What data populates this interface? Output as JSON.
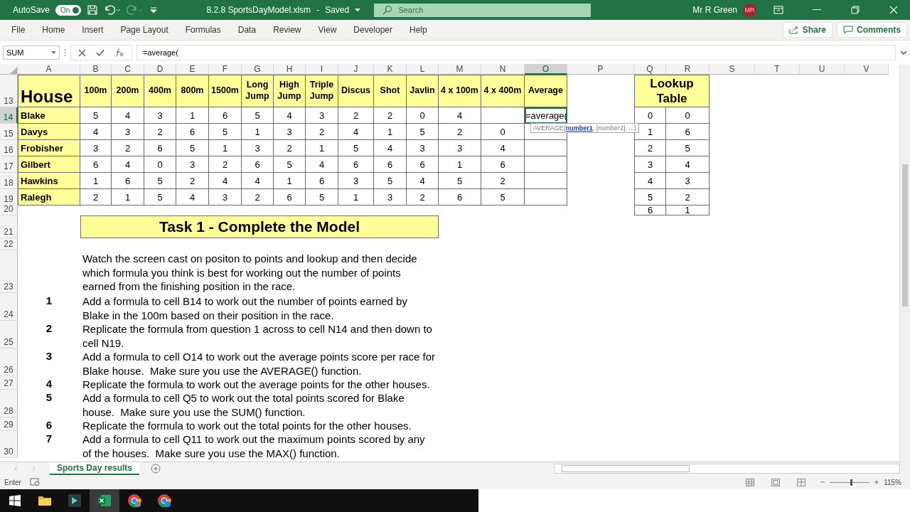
{
  "title_bar": {
    "autosave": "AutoSave",
    "autosave_toggle": {
      "label": "On",
      "on": true
    },
    "file_name": "8.2.8 SportsDayModel.xlsm",
    "separator": "-",
    "status": "Saved",
    "search": {
      "placeholder": "Search"
    },
    "user": "Mr R Green",
    "avatar": "MR"
  },
  "ribbon_tabs": [
    "File",
    "Home",
    "Insert",
    "Page Layout",
    "Formulas",
    "Data",
    "Review",
    "View",
    "Developer",
    "Help"
  ],
  "ribbon_buttons": [
    "Share",
    "Comments"
  ],
  "formula_bar": {
    "name_box": "SUM",
    "formula": "=average("
  },
  "columns": [
    {
      "label": "A",
      "selected": false
    },
    {
      "label": "B",
      "selected": false
    },
    {
      "label": "C",
      "selected": false
    },
    {
      "label": "D",
      "selected": false
    },
    {
      "label": "E",
      "selected": false
    },
    {
      "label": "F",
      "selected": false
    },
    {
      "label": "G",
      "selected": false
    },
    {
      "label": "H",
      "selected": false
    },
    {
      "label": "I",
      "selected": false
    },
    {
      "label": "J",
      "selected": false
    },
    {
      "label": "K",
      "selected": false
    },
    {
      "label": "L",
      "selected": false
    },
    {
      "label": "M",
      "selected": false
    },
    {
      "label": "N",
      "selected": false
    },
    {
      "label": "O",
      "selected": true
    },
    {
      "label": "P",
      "selected": false
    },
    {
      "label": "Q",
      "selected": false
    },
    {
      "label": "R",
      "selected": false
    },
    {
      "label": "S",
      "selected": false
    },
    {
      "label": "T",
      "selected": false
    },
    {
      "label": "U",
      "selected": false
    },
    {
      "label": "V",
      "selected": false
    }
  ],
  "row_numbers": [
    {
      "label": "13",
      "selected": false
    },
    {
      "label": "14",
      "selected": true
    },
    {
      "label": "15",
      "selected": false
    },
    {
      "label": "16",
      "selected": false
    },
    {
      "label": "17",
      "selected": false
    },
    {
      "label": "18",
      "selected": false
    },
    {
      "label": "19",
      "selected": false
    },
    {
      "label": "20",
      "selected": false
    },
    {
      "label": "21",
      "selected": false
    },
    {
      "label": "22",
      "selected": false
    },
    {
      "label": "23",
      "selected": false
    },
    {
      "label": "24",
      "selected": false
    },
    {
      "label": "25",
      "selected": false
    },
    {
      "label": "26",
      "selected": false
    },
    {
      "label": "27",
      "selected": false
    },
    {
      "label": "28",
      "selected": false
    },
    {
      "label": "29",
      "selected": false
    },
    {
      "label": "30",
      "selected": false
    }
  ],
  "table": {
    "house_header": "House",
    "events": [
      "100m",
      "200m",
      "400m",
      "800m",
      "1500m",
      "Long Jump",
      "High Jump",
      "Triple Jump",
      "Discus",
      "Shot",
      "Javlin",
      "4 x 100m",
      "4 x 400m"
    ],
    "average_header": "Average",
    "formula_tip": "AVERAGE(**number1**, [number2], ...)",
    "rows": [
      {
        "house": "Blake",
        "points": [
          "5",
          "4",
          "3",
          "1",
          "6",
          "5",
          "4",
          "3",
          "2",
          "2",
          "0",
          "4"
        ],
        "average": "=average(",
        "editing": true
      },
      {
        "house": "Davys",
        "points": [
          "4",
          "3",
          "2",
          "6",
          "5",
          "1",
          "3",
          "2",
          "4",
          "1",
          "5",
          "2",
          "0"
        ],
        "editing": false
      },
      {
        "house": "Frobisher",
        "points": [
          "3",
          "2",
          "6",
          "5",
          "1",
          "3",
          "2",
          "1",
          "5",
          "4",
          "3",
          "3",
          "4"
        ],
        "editing": false
      },
      {
        "house": "Gilbert",
        "points": [
          "6",
          "4",
          "0",
          "3",
          "2",
          "6",
          "5",
          "4",
          "6",
          "6",
          "6",
          "1",
          "6"
        ],
        "editing": false
      },
      {
        "house": "Hawkins",
        "points": [
          "1",
          "6",
          "5",
          "2",
          "4",
          "4",
          "1",
          "6",
          "3",
          "5",
          "4",
          "5",
          "2"
        ],
        "editing": false
      },
      {
        "house": "Ralegh",
        "points": [
          "2",
          "1",
          "5",
          "4",
          "3",
          "2",
          "6",
          "5",
          "1",
          "3",
          "2",
          "6",
          "5"
        ],
        "editing": false
      }
    ]
  },
  "lookup": {
    "title": "Lookup Table",
    "rows": [
      [
        "0",
        "0"
      ],
      [
        "1",
        "6"
      ],
      [
        "2",
        "5"
      ],
      [
        "3",
        "4"
      ],
      [
        "4",
        "3"
      ],
      [
        "5",
        "2"
      ],
      [
        "6",
        "1"
      ]
    ]
  },
  "task": {
    "title": "Task 1 - Complete the Model",
    "intro": "Watch the screen cast on positon to points and lookup and then decide which formula you think is best for working out the number of points earned from the finishing position in the race.",
    "steps": [
      {
        "number": "1",
        "text": "Add a formula to cell B14 to work out the number of points earned by Blake in the 100m based on their position in the race."
      },
      {
        "number": "2",
        "text": "Replicate the formula from question 1 across to cell N14 and then down to cell N19."
      },
      {
        "number": "3",
        "text": "Add a formula to cell O14 to work out the average points score per race for Blake house.  Make sure you use the AVERAGE() function."
      },
      {
        "number": "4",
        "text": "Replicate the formula to work out the average points for the other houses."
      },
      {
        "number": "5",
        "text": "Add a formula to cell Q5 to work out the total points scored for Blake house.  Make sure you use the SUM() function."
      },
      {
        "number": "6",
        "text": "Replicate the formula to work out the total points for the other houses."
      },
      {
        "number": "7",
        "text": "Add a formula to cell Q11 to work out the maximum points scored by any of the houses.  Make sure you use the MAX() function."
      }
    ]
  },
  "sheet_tabs": [
    {
      "label": "Sports Day results",
      "selected": true
    }
  ],
  "status_bar": {
    "mode": "Enter",
    "zoom": {
      "level": 0.52,
      "reading": "115%"
    }
  }
}
